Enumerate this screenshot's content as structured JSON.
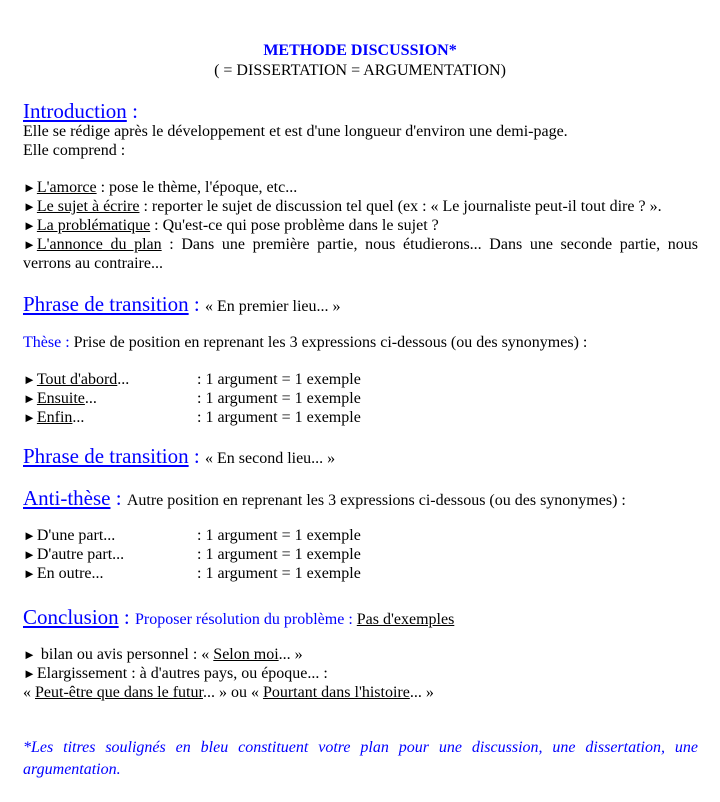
{
  "header": {
    "title": "METHODE DISCUSSION*",
    "subtitle": "( = DISSERTATION = ARGUMENTATION)"
  },
  "introduction": {
    "heading": "Introduction",
    "sep": " :",
    "lines": [
      "Elle se rédige après le développement et est d'une longueur d'environ une demi-page.",
      "Elle comprend :"
    ],
    "items": [
      {
        "label": "L'amorce",
        "text": " : pose le thème, l'époque, etc..."
      },
      {
        "label": "Le sujet à écrire",
        "text": " : reporter le sujet de discussion tel quel (ex : « Le journaliste peut-il tout dire ? »."
      },
      {
        "label": "La problématique",
        "text": " : Qu'est-ce qui pose problème dans le sujet ?"
      },
      {
        "label": "L'annonce du plan",
        "text": " : Dans une première partie, nous étudierons... Dans une seconde partie, nous verrons au contraire..."
      }
    ]
  },
  "transition1": {
    "heading": "Phrase de transition",
    "sep": " : ",
    "text": "« En premier lieu... »"
  },
  "these": {
    "heading": "Thèse :",
    "text": " Prise de position en reprenant les 3 expressions ci-dessous (ou des synonymes) :",
    "items": [
      {
        "label": "Tout d'abord",
        "suffix": "...",
        "value": ": 1 argument = 1 exemple"
      },
      {
        "label": "Ensuite",
        "suffix": "...",
        "value": ": 1 argument = 1 exemple"
      },
      {
        "label": "Enfin",
        "suffix": "...",
        "value": ": 1 argument = 1 exemple"
      }
    ]
  },
  "transition2": {
    "heading": "Phrase de transition",
    "sep": " : ",
    "text": "« En second lieu... »"
  },
  "antithese": {
    "heading": "Anti-thèse",
    "sep": " : ",
    "text": "Autre position en reprenant les 3 expressions ci-dessous (ou des synonymes) :",
    "items": [
      {
        "label": "D'une part...",
        "value": ": 1 argument = 1 exemple"
      },
      {
        "label": "D'autre part...",
        "value": ": 1 argument = 1 exemple"
      },
      {
        "label": "En outre...",
        "value": ": 1 argument = 1 exemple"
      }
    ]
  },
  "conclusion": {
    "heading": "Conclusion",
    "sep": " : ",
    "subtitle": "Proposer résolution du problème : ",
    "no_examples": "Pas d'exemples",
    "item1_pre": " bilan ou avis personnel : « ",
    "item1_link": "Selon moi",
    "item1_post": "... »",
    "item2": "Elargissement : à d'autres pays, ou époque... :",
    "item3_pre": "« ",
    "item3_link1": "Peut-être que dans le futur",
    "item3_mid": "... » ou « ",
    "item3_link2": "Pourtant dans l'histoire",
    "item3_post": "... »"
  },
  "footnote": "*Les titres soulignés en bleu constituent votre plan pour une discussion, une dissertation, une argumentation.",
  "bullet_glyph": "►"
}
